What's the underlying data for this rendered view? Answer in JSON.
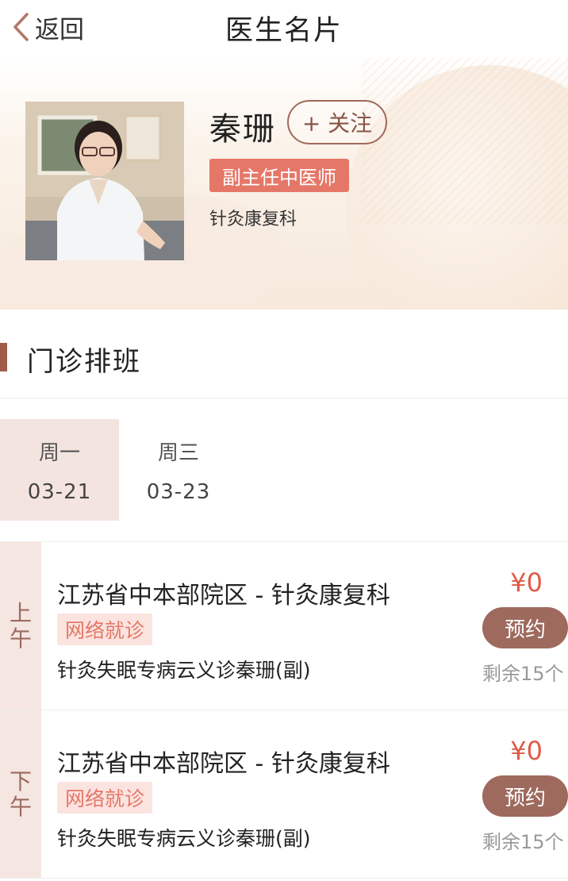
{
  "nav": {
    "back_label": "返回",
    "title": "医生名片"
  },
  "doctor": {
    "name": "秦珊",
    "follow_label": "+ 关注",
    "title": "副主任中医师",
    "department": "针灸康复科"
  },
  "schedule": {
    "section_title": "门诊排班",
    "tabs": [
      {
        "day": "周一",
        "date": "03-21",
        "active": true
      },
      {
        "day": "周三",
        "date": "03-23",
        "active": false
      }
    ],
    "slots": [
      {
        "period": [
          "上",
          "午"
        ],
        "location": "江苏省中本部院区 - 针灸康复科",
        "mode": "网络就诊",
        "service": "针灸失眠专病云义诊秦珊(副)",
        "price": "¥0",
        "book_label": "预约",
        "remaining": "剩余15个"
      },
      {
        "period": [
          "下",
          "午"
        ],
        "location": "江苏省中本部院区 - 针灸康复科",
        "mode": "网络就诊",
        "service": "针灸失眠专病云义诊秦珊(副)",
        "price": "¥0",
        "book_label": "预约",
        "remaining": "剩余15个"
      }
    ]
  },
  "colors": {
    "accent": "#e57768",
    "brown": "#9e6a5d",
    "price": "#e05a48",
    "tab_active_bg": "#f4e4df"
  }
}
